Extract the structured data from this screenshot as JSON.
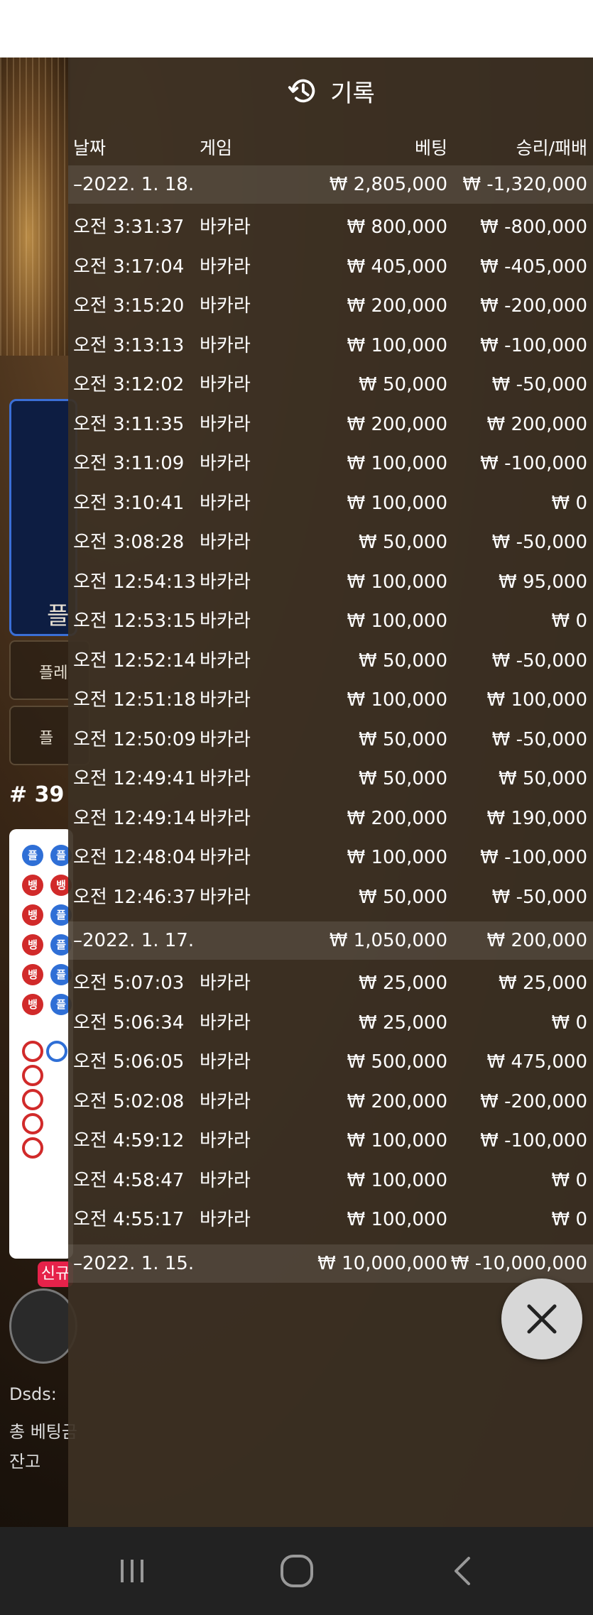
{
  "panel": {
    "title": "기록",
    "title_icon": "history-icon"
  },
  "columns": {
    "date": "날짜",
    "game": "게임",
    "bet": "베팅",
    "result": "승리/패배"
  },
  "groups": [
    {
      "date": "–2022. 1. 18.",
      "bet": "₩ 2,805,000",
      "result": "₩ -1,320,000",
      "rows": [
        {
          "time": "오전 3:31:37",
          "game": "바카라",
          "bet": "₩ 800,000",
          "result": "₩ -800,000"
        },
        {
          "time": "오전 3:17:04",
          "game": "바카라",
          "bet": "₩ 405,000",
          "result": "₩ -405,000"
        },
        {
          "time": "오전 3:15:20",
          "game": "바카라",
          "bet": "₩ 200,000",
          "result": "₩ -200,000"
        },
        {
          "time": "오전 3:13:13",
          "game": "바카라",
          "bet": "₩ 100,000",
          "result": "₩ -100,000"
        },
        {
          "time": "오전 3:12:02",
          "game": "바카라",
          "bet": "₩ 50,000",
          "result": "₩ -50,000"
        },
        {
          "time": "오전 3:11:35",
          "game": "바카라",
          "bet": "₩ 200,000",
          "result": "₩ 200,000"
        },
        {
          "time": "오전 3:11:09",
          "game": "바카라",
          "bet": "₩ 100,000",
          "result": "₩ -100,000"
        },
        {
          "time": "오전 3:10:41",
          "game": "바카라",
          "bet": "₩ 100,000",
          "result": "₩ 0"
        },
        {
          "time": "오전 3:08:28",
          "game": "바카라",
          "bet": "₩ 50,000",
          "result": "₩ -50,000"
        },
        {
          "time": "오전 12:54:13",
          "game": "바카라",
          "bet": "₩ 100,000",
          "result": "₩ 95,000"
        },
        {
          "time": "오전 12:53:15",
          "game": "바카라",
          "bet": "₩ 100,000",
          "result": "₩ 0"
        },
        {
          "time": "오전 12:52:14",
          "game": "바카라",
          "bet": "₩ 50,000",
          "result": "₩ -50,000"
        },
        {
          "time": "오전 12:51:18",
          "game": "바카라",
          "bet": "₩ 100,000",
          "result": "₩ 100,000"
        },
        {
          "time": "오전 12:50:09",
          "game": "바카라",
          "bet": "₩ 50,000",
          "result": "₩ -50,000"
        },
        {
          "time": "오전 12:49:41",
          "game": "바카라",
          "bet": "₩ 50,000",
          "result": "₩ 50,000"
        },
        {
          "time": "오전 12:49:14",
          "game": "바카라",
          "bet": "₩ 200,000",
          "result": "₩ 190,000"
        },
        {
          "time": "오전 12:48:04",
          "game": "바카라",
          "bet": "₩ 100,000",
          "result": "₩ -100,000"
        },
        {
          "time": "오전 12:46:37",
          "game": "바카라",
          "bet": "₩ 50,000",
          "result": "₩ -50,000"
        }
      ]
    },
    {
      "date": "–2022. 1. 17.",
      "bet": "₩ 1,050,000",
      "result": "₩ 200,000",
      "rows": [
        {
          "time": "오전 5:07:03",
          "game": "바카라",
          "bet": "₩ 25,000",
          "result": "₩ 25,000"
        },
        {
          "time": "오전 5:06:34",
          "game": "바카라",
          "bet": "₩ 25,000",
          "result": "₩ 0"
        },
        {
          "time": "오전 5:06:05",
          "game": "바카라",
          "bet": "₩ 500,000",
          "result": "₩ 475,000"
        },
        {
          "time": "오전 5:02:08",
          "game": "바카라",
          "bet": "₩ 200,000",
          "result": "₩ -200,000"
        },
        {
          "time": "오전 4:59:12",
          "game": "바카라",
          "bet": "₩ 100,000",
          "result": "₩ -100,000"
        },
        {
          "time": "오전 4:58:47",
          "game": "바카라",
          "bet": "₩ 100,000",
          "result": "₩ 0"
        },
        {
          "time": "오전 4:55:17",
          "game": "바카라",
          "bet": "₩ 100,000",
          "result": "₩ 0"
        }
      ]
    },
    {
      "date": "–2022. 1. 15.",
      "bet": "₩ 10,000,000",
      "result": "₩ -10,000,000",
      "rows": []
    }
  ],
  "background": {
    "label_big": "플",
    "button1": "플레",
    "button2": "플",
    "round": "# 39",
    "badge": "신규",
    "user": "Dsds:",
    "total_bet": "총 베팅금",
    "balance": "잔고"
  },
  "close_icon": "close-icon",
  "navbar": {
    "recents_icon": "recents-icon",
    "home_icon": "home-icon",
    "back_icon": "back-icon"
  }
}
